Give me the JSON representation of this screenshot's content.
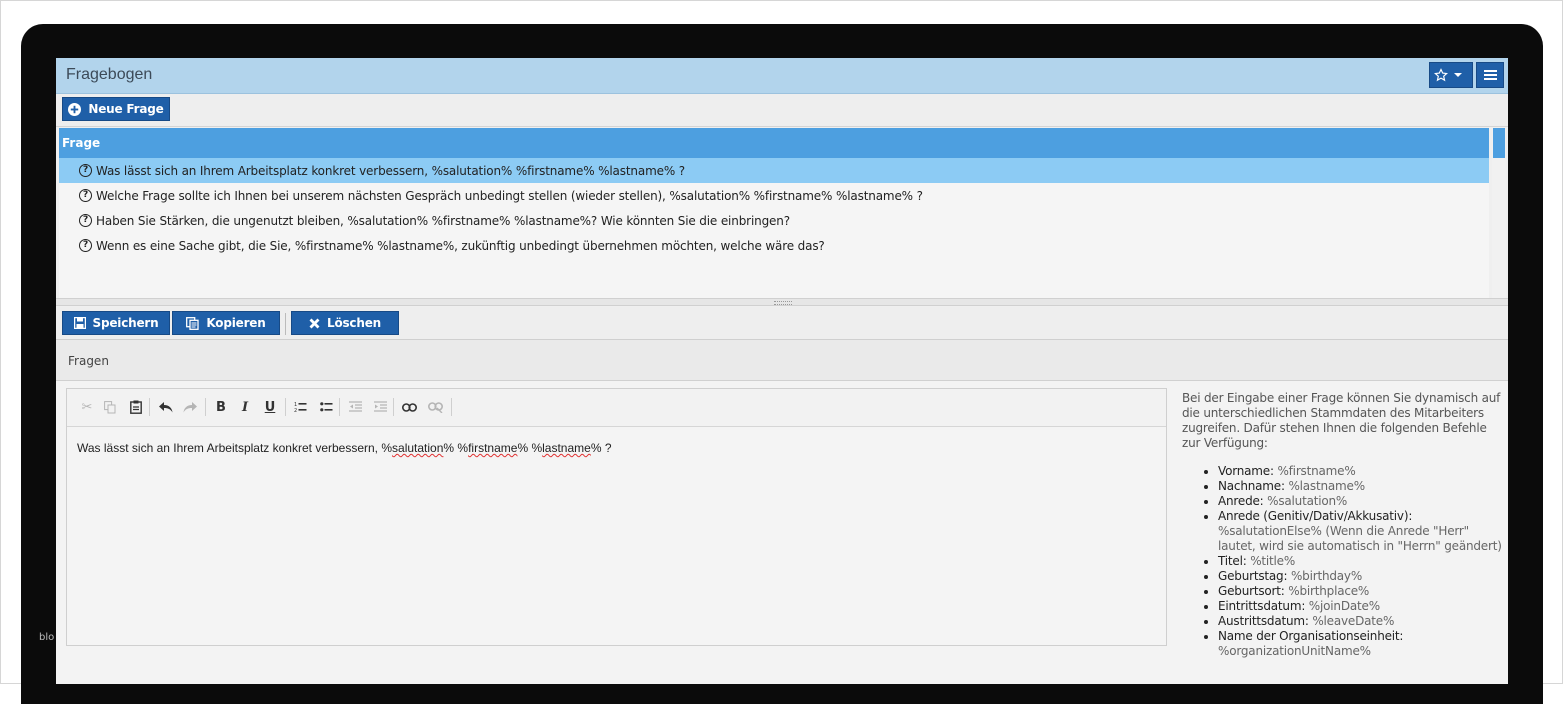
{
  "side_label": "blo",
  "header": {
    "title": "Fragebogen"
  },
  "toolbar": {
    "new_question": "Neue Frage"
  },
  "list": {
    "column_header": "Frage",
    "rows": [
      "Was lässt sich an Ihrem Arbeitsplatz konkret verbessern, %salutation% %firstname% %lastname% ?",
      "Welche Frage sollte ich Ihnen bei unserem nächsten Gespräch unbedingt stellen (wieder stellen), %salutation% %firstname% %lastname% ?",
      "Haben Sie Stärken, die ungenutzt bleiben, %salutation% %firstname% %lastname%? Wie könnten Sie die einbringen?",
      "Wenn es eine Sache gibt, die Sie, %firstname% %lastname%, zukünftig unbedingt übernehmen möchten, welche wäre das?"
    ],
    "selected_index": 0
  },
  "actions": {
    "save": "Speichern",
    "copy": "Kopieren",
    "delete": "Löschen"
  },
  "section": {
    "title": "Fragen"
  },
  "editor": {
    "text_prefix": "Was lässt sich an Ihrem Arbeitsplatz konkret verbessern, %",
    "salutation": "salutation",
    "mid1": "% %",
    "firstname": "firstname",
    "mid2": "% %",
    "lastname": "lastname",
    "suffix": "% ?"
  },
  "help": {
    "intro": "Bei der Eingabe einer Frage können Sie dynamisch auf die unterschiedlichen Stammdaten des Mitarbeiters zugreifen. Dafür stehen Ihnen die folgenden Befehle zur Verfügung:",
    "items": [
      {
        "label": "Vorname:",
        "code": "%firstname%"
      },
      {
        "label": "Nachname:",
        "code": "%lastname%"
      },
      {
        "label": "Anrede:",
        "code": "%salutation%"
      },
      {
        "label": "Anrede (Genitiv/Dativ/Akkusativ):",
        "code": "%salutationElse%",
        "note": "(Wenn die Anrede \"Herr\" lautet, wird sie automatisch in \"Herrn\" geändert)"
      },
      {
        "label": "Titel:",
        "code": "%title%"
      },
      {
        "label": "Geburtstag:",
        "code": "%birthday%"
      },
      {
        "label": "Geburtsort:",
        "code": "%birthplace%"
      },
      {
        "label": "Eintrittsdatum:",
        "code": "%joinDate%"
      },
      {
        "label": "Austrittsdatum:",
        "code": "%leaveDate%"
      },
      {
        "label": "Name der Organisationseinheit:",
        "code": "%organizationUnitName%"
      }
    ]
  },
  "colors": {
    "primary": "#1f5fa8",
    "header_bg": "#b2d4ec",
    "list_header": "#4d9fe0",
    "selected_row": "#8ccbf4"
  }
}
